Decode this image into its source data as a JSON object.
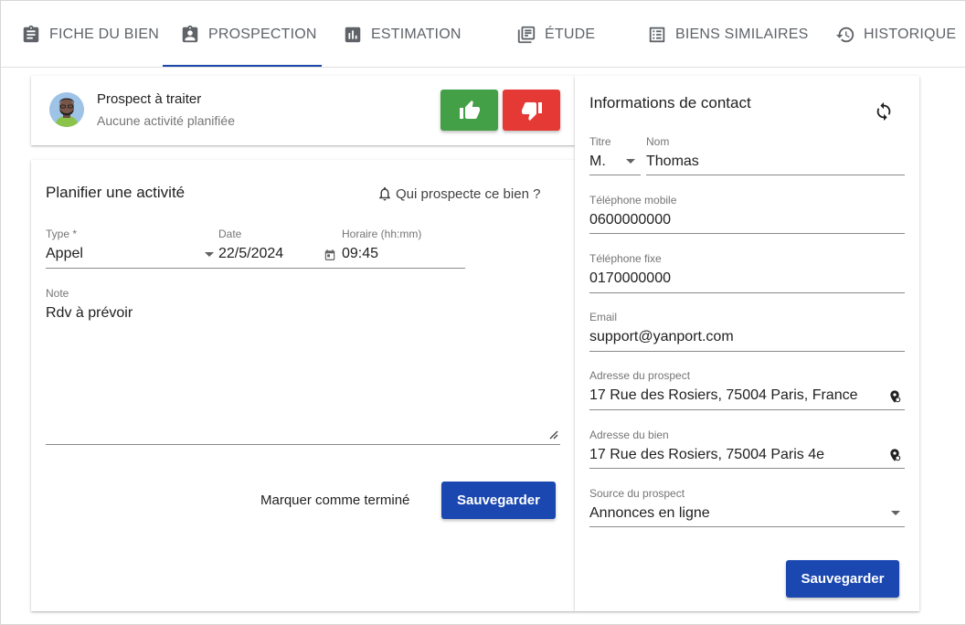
{
  "tabs": [
    {
      "label": "FICHE DU BIEN",
      "icon": "clipboard-icon"
    },
    {
      "label": "PROSPECTION",
      "icon": "badge-icon"
    },
    {
      "label": "ESTIMATION",
      "icon": "bar-chart-icon"
    },
    {
      "label": "ÉTUDE",
      "icon": "library-icon"
    },
    {
      "label": "BIENS SIMILAIRES",
      "icon": "list-icon"
    },
    {
      "label": "HISTORIQUE",
      "icon": "history-icon"
    }
  ],
  "status": {
    "title": "Prospect à traiter",
    "subtitle": "Aucune activité planifiée"
  },
  "activity": {
    "title": "Planifier une activité",
    "who_link": "Qui prospecte ce bien ?",
    "type_label": "Type *",
    "type_value": "Appel",
    "date_label": "Date",
    "date_value": "22/5/2024",
    "time_label": "Horaire (hh:mm)",
    "time_value": "09:45",
    "note_label": "Note",
    "note_value": "Rdv à prévoir",
    "mark_done": "Marquer comme terminé",
    "save": "Sauvegarder"
  },
  "contact": {
    "title": "Informations de contact",
    "civility_label": "Titre",
    "civility_value": "M.",
    "name_label": "Nom",
    "name_value": "Thomas",
    "mobile_label": "Téléphone mobile",
    "mobile_value": "0600000000",
    "landline_label": "Téléphone fixe",
    "landline_value": "0170000000",
    "email_label": "Email",
    "email_value": "support@yanport.com",
    "prospect_address_label": "Adresse du prospect",
    "prospect_address_value": "17 Rue des Rosiers, 75004 Paris, France",
    "property_address_label": "Adresse du bien",
    "property_address_value": "17 Rue des Rosiers, 75004 Paris 4e",
    "source_label": "Source du prospect",
    "source_value": "Annonces en ligne",
    "save": "Sauvegarder"
  },
  "colors": {
    "accent": "#1a47b0",
    "thumbs_up": "#43a047",
    "thumbs_down": "#e53935"
  }
}
